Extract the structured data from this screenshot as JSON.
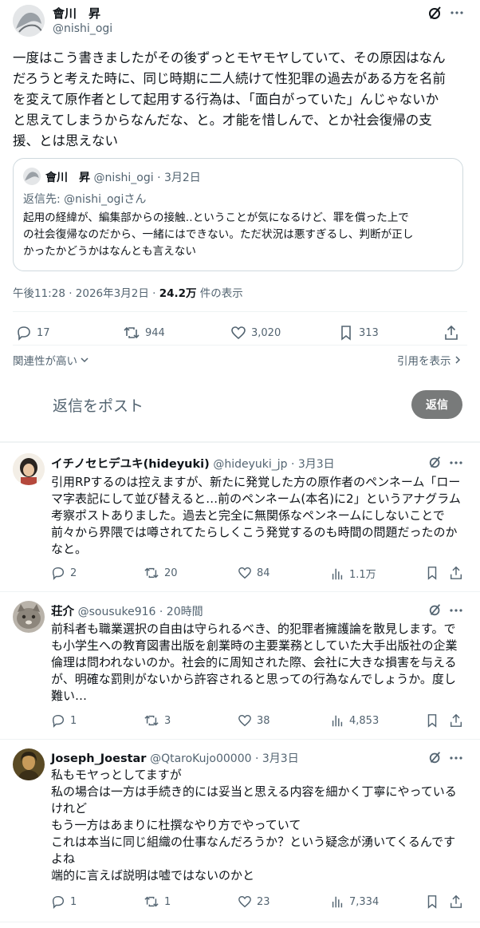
{
  "main_post": {
    "author_name": "會川　昇",
    "author_handle": "@nishi_ogi",
    "text_lines": [
      "一度はこう書きましたがその後ずっとモヤモヤしていて、その原因はなん",
      "だろうと考えた時に、同じ時期に二人続けて性犯罪の過去がある方を名前",
      "を変えて原作者として起用する行為は、「面白がっていた」んじゃないか",
      "と思えてしまうからなんだな、と。才能を惜しんで、とか社会復帰の支",
      "援、とは思えない"
    ],
    "quote": {
      "author_name": "會川　昇",
      "author_handle": "@nishi_ogi",
      "date": "· 3月2日",
      "reply_to": "返信先: @nishi_ogiさん",
      "text_lines": [
        "起用の経緯が、編集部からの接触‥ということが気になるけど、罪を償った上で",
        "の社会復帰なのだから、一緒にはできない。ただ状況は悪すぎるし、判断が正し",
        "かったかどうかはなんとも言えない"
      ]
    },
    "meta_time": "午後11:28 · 2026年3月2日 · ",
    "meta_views": "24.2万",
    "meta_views_suffix": " 件の表示",
    "replies": "17",
    "reposts": "944",
    "likes": "3,020",
    "bookmarks": "313",
    "sort_label": "関連性が高い",
    "quotes_link": "引用を表示"
  },
  "compose": {
    "placeholder": "返信をポスト",
    "button_label": "返信"
  },
  "replies": [
    {
      "name": "イチノセヒデユキ(hideyuki)",
      "handle": "@hideyuki_jp · 3月3日",
      "lines": [
        "引用RPするのは控えますが、新たに発覚した方の原作者のペンネーム「ロー",
        "マ字表記にして並び替えると…前のペンネーム(本名)に2」というアナグラム",
        "考察ポストありました。過去と完全に無関係なペンネームにしないことで",
        "前々から界隈では噂されてたらしくこう発覚するのも時間の問題だったのか",
        "なと。"
      ],
      "replies": "2",
      "reposts": "20",
      "likes": "84",
      "views": "1.1万"
    },
    {
      "name": "荘介",
      "handle": "@sousuke916 · 20時間",
      "lines": [
        "前科者も職業選択の自由は守られるべき、的犯罪者擁護論を散見します。で",
        "も小学生への教育図書出版を創業時の主要業務としていた大手出版社の企業",
        "倫理は問われないのか。社会的に周知された際、会社に大きな損害を与える",
        "が、明確な罰則がないから許容されると思っての行為なんでしょうか。度し",
        "難い…"
      ],
      "replies": "1",
      "reposts": "3",
      "likes": "38",
      "views": "4,853"
    },
    {
      "name": "Joseph_Joestar",
      "handle": "@QtaroKujo00000 · 3月3日",
      "lines": [
        "私もモヤっとしてますが",
        "私の場合は一方は手続き的には妥当と思える内容を細かく丁寧にやっている",
        "けれど",
        "もう一方はあまりに杜撰なやり方でやっていて",
        "これは本当に同じ組織の仕事なんだろうか？という疑念が湧いてくるんです",
        "よね",
        "端的に言えば説明は嘘ではないのかと"
      ],
      "replies": "1",
      "reposts": "1",
      "likes": "23",
      "views": "7,334"
    }
  ],
  "colors": {
    "text": "#0f1419",
    "muted": "#536471",
    "divider": "#eff3f4",
    "button": "#787a7a"
  }
}
